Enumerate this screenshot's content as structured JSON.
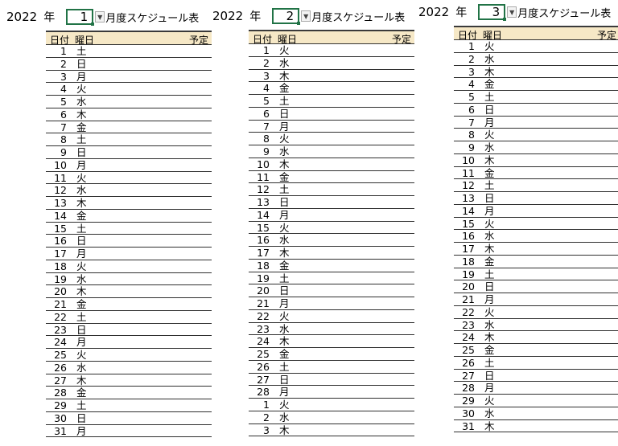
{
  "panels": [
    {
      "year": "2022",
      "year_unit": "年",
      "month": "1",
      "title_suffix": "月度スケジュール表",
      "headers": {
        "date": "日付",
        "weekday": "曜日",
        "plan": "予定"
      },
      "rows": [
        {
          "d": "1",
          "w": "土"
        },
        {
          "d": "2",
          "w": "日"
        },
        {
          "d": "3",
          "w": "月"
        },
        {
          "d": "4",
          "w": "火"
        },
        {
          "d": "5",
          "w": "水"
        },
        {
          "d": "6",
          "w": "木"
        },
        {
          "d": "7",
          "w": "金"
        },
        {
          "d": "8",
          "w": "土"
        },
        {
          "d": "9",
          "w": "日"
        },
        {
          "d": "10",
          "w": "月"
        },
        {
          "d": "11",
          "w": "火"
        },
        {
          "d": "12",
          "w": "水"
        },
        {
          "d": "13",
          "w": "木"
        },
        {
          "d": "14",
          "w": "金"
        },
        {
          "d": "15",
          "w": "土"
        },
        {
          "d": "16",
          "w": "日"
        },
        {
          "d": "17",
          "w": "月"
        },
        {
          "d": "18",
          "w": "火"
        },
        {
          "d": "19",
          "w": "水"
        },
        {
          "d": "20",
          "w": "木"
        },
        {
          "d": "21",
          "w": "金"
        },
        {
          "d": "22",
          "w": "土"
        },
        {
          "d": "23",
          "w": "日"
        },
        {
          "d": "24",
          "w": "月"
        },
        {
          "d": "25",
          "w": "火"
        },
        {
          "d": "26",
          "w": "水"
        },
        {
          "d": "27",
          "w": "木"
        },
        {
          "d": "28",
          "w": "金"
        },
        {
          "d": "29",
          "w": "土"
        },
        {
          "d": "30",
          "w": "日"
        },
        {
          "d": "31",
          "w": "月"
        }
      ]
    },
    {
      "year": "2022",
      "year_unit": "年",
      "month": "2",
      "title_suffix": "月度スケジュール表",
      "headers": {
        "date": "日付",
        "weekday": "曜日",
        "plan": "予定"
      },
      "rows": [
        {
          "d": "1",
          "w": "火"
        },
        {
          "d": "2",
          "w": "水"
        },
        {
          "d": "3",
          "w": "木"
        },
        {
          "d": "4",
          "w": "金"
        },
        {
          "d": "5",
          "w": "土"
        },
        {
          "d": "6",
          "w": "日"
        },
        {
          "d": "7",
          "w": "月"
        },
        {
          "d": "8",
          "w": "火"
        },
        {
          "d": "9",
          "w": "水"
        },
        {
          "d": "10",
          "w": "木"
        },
        {
          "d": "11",
          "w": "金"
        },
        {
          "d": "12",
          "w": "土"
        },
        {
          "d": "13",
          "w": "日"
        },
        {
          "d": "14",
          "w": "月"
        },
        {
          "d": "15",
          "w": "火"
        },
        {
          "d": "16",
          "w": "水"
        },
        {
          "d": "17",
          "w": "木"
        },
        {
          "d": "18",
          "w": "金"
        },
        {
          "d": "19",
          "w": "土"
        },
        {
          "d": "20",
          "w": "日"
        },
        {
          "d": "21",
          "w": "月"
        },
        {
          "d": "22",
          "w": "火"
        },
        {
          "d": "23",
          "w": "水"
        },
        {
          "d": "24",
          "w": "木"
        },
        {
          "d": "25",
          "w": "金"
        },
        {
          "d": "26",
          "w": "土"
        },
        {
          "d": "27",
          "w": "日"
        },
        {
          "d": "28",
          "w": "月"
        },
        {
          "d": "1",
          "w": "火"
        },
        {
          "d": "2",
          "w": "水"
        },
        {
          "d": "3",
          "w": "木"
        }
      ]
    },
    {
      "year": "2022",
      "year_unit": "年",
      "month": "3",
      "title_suffix": "月度スケジュール表",
      "headers": {
        "date": "日付",
        "weekday": "曜日",
        "plan": "予定"
      },
      "rows": [
        {
          "d": "1",
          "w": "火"
        },
        {
          "d": "2",
          "w": "水"
        },
        {
          "d": "3",
          "w": "木"
        },
        {
          "d": "4",
          "w": "金"
        },
        {
          "d": "5",
          "w": "土"
        },
        {
          "d": "6",
          "w": "日"
        },
        {
          "d": "7",
          "w": "月"
        },
        {
          "d": "8",
          "w": "火"
        },
        {
          "d": "9",
          "w": "水"
        },
        {
          "d": "10",
          "w": "木"
        },
        {
          "d": "11",
          "w": "金"
        },
        {
          "d": "12",
          "w": "土"
        },
        {
          "d": "13",
          "w": "日"
        },
        {
          "d": "14",
          "w": "月"
        },
        {
          "d": "15",
          "w": "火"
        },
        {
          "d": "16",
          "w": "水"
        },
        {
          "d": "17",
          "w": "木"
        },
        {
          "d": "18",
          "w": "金"
        },
        {
          "d": "19",
          "w": "土"
        },
        {
          "d": "20",
          "w": "日"
        },
        {
          "d": "21",
          "w": "月"
        },
        {
          "d": "22",
          "w": "火"
        },
        {
          "d": "23",
          "w": "水"
        },
        {
          "d": "24",
          "w": "木"
        },
        {
          "d": "25",
          "w": "金"
        },
        {
          "d": "26",
          "w": "土"
        },
        {
          "d": "27",
          "w": "日"
        },
        {
          "d": "28",
          "w": "月"
        },
        {
          "d": "29",
          "w": "火"
        },
        {
          "d": "30",
          "w": "水"
        },
        {
          "d": "31",
          "w": "木"
        }
      ]
    }
  ],
  "colors": {
    "header_fill": "#f6e8c6",
    "cell_selection": "#217346"
  }
}
